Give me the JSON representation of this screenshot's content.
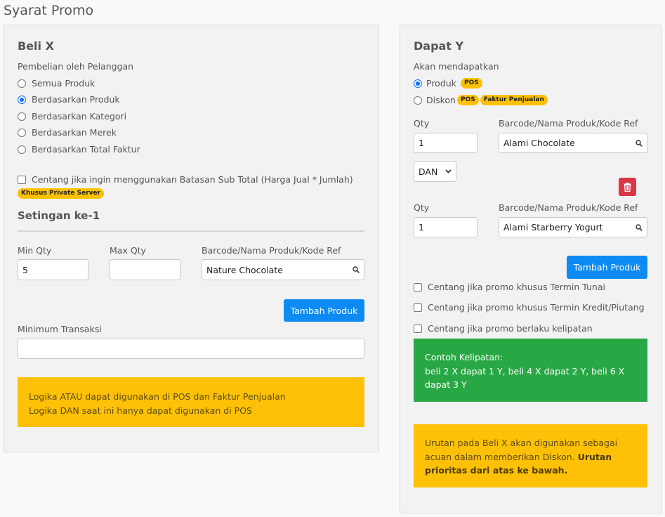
{
  "page_title": "Syarat Promo",
  "left": {
    "title": "Beli X",
    "purchase_label": "Pembelian oleh Pelanggan",
    "options": [
      {
        "label": "Semua Produk",
        "selected": false
      },
      {
        "label": "Berdasarkan Produk",
        "selected": true
      },
      {
        "label": "Berdasarkan Kategori",
        "selected": false
      },
      {
        "label": "Berdasarkan Merek",
        "selected": false
      },
      {
        "label": "Berdasarkan Total Faktur",
        "selected": false
      }
    ],
    "subtotal_check_label": "Centang jika ingin menggunakan Batasan Sub Total (Harga Jual * Jumlah)",
    "private_badge": "Khusus Private Server",
    "settings_title": "Setingan ke-1",
    "min_qty_label": "Min Qty",
    "min_qty_value": "5",
    "max_qty_label": "Max Qty",
    "max_qty_value": "",
    "barcode_label": "Barcode/Nama Produk/Kode Ref",
    "barcode_value": "Nature Chocolate",
    "add_product": "Tambah Produk",
    "min_trans_label": "Minimum Transaksi",
    "min_trans_value": "",
    "alert_line1": "Logika ATAU dapat digunakan di POS dan Faktur Penjualan",
    "alert_line2": "Logika DAN saat ini hanya dapat digunakan di POS"
  },
  "right": {
    "title": "Dapat Y",
    "get_label": "Akan mendapatkan",
    "opt_product": "Produk",
    "opt_discount": "Diskon",
    "badge_pos": "POS",
    "badge_faktur": "Faktur Penjualan",
    "qty_label": "Qty",
    "barcode_label": "Barcode/Nama Produk/Kode Ref",
    "item1_qty": "1",
    "item1_product": "Alami Chocolate",
    "logic_value": "DAN",
    "item2_qty": "1",
    "item2_product": "Alami Starberry Yogurt",
    "add_product": "Tambah Produk",
    "check_cash": "Centang jika promo khusus Termin Tunai",
    "check_credit": "Centang jika promo khusus Termin Kredit/Piutang",
    "check_multiple": "Centang jika promo berlaku kelipatan",
    "example_title": "Contoh Kelipatan:",
    "example_text": "beli 2 X dapat 1 Y, beli 4 X dapat 2 Y, beli 6 X dapat 3 Y",
    "note_text": "Urutan pada Beli X akan digunakan sebagai acuan dalam memberikan Diskon.",
    "note_bold": "Urutan prioritas dari atas ke bawah."
  },
  "colors": {
    "primary": "#0d8bf2",
    "warning": "#ffc107",
    "success": "#28a745",
    "danger": "#dc3545"
  }
}
